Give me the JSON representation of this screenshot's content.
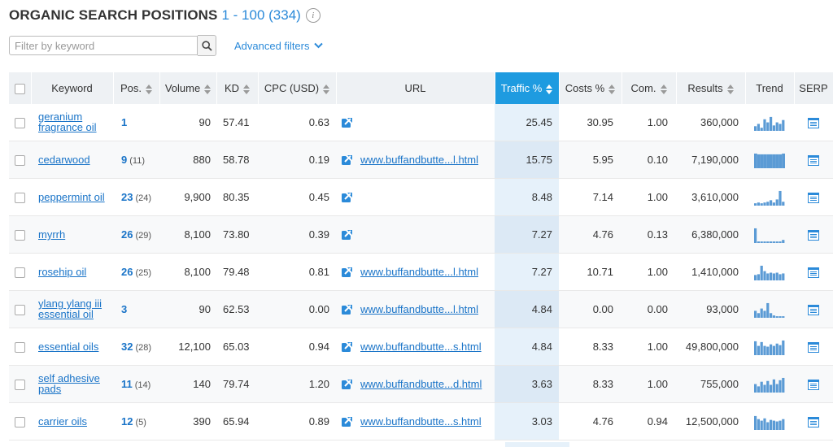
{
  "header": {
    "title": "ORGANIC SEARCH POSITIONS",
    "range": "1 - 100 (334)",
    "info_icon": "info-icon"
  },
  "filter": {
    "placeholder": "Filter by keyword",
    "search_icon": "magnifier-icon",
    "advanced_label": "Advanced filters"
  },
  "columns": {
    "keyword": "Keyword",
    "pos": "Pos.",
    "volume": "Volume",
    "kd": "KD",
    "cpc": "CPC (USD)",
    "url": "URL",
    "traffic": "Traffic %",
    "costs": "Costs %",
    "com": "Com.",
    "results": "Results",
    "trend": "Trend",
    "serp": "SERP"
  },
  "colors": {
    "accent": "#1e9be0",
    "link": "#1a74c8",
    "trend_bar": "#5b9bd5"
  },
  "rows": [
    {
      "keyword": "geranium fragrance oil",
      "pos": "1",
      "prev": "",
      "volume": "90",
      "kd": "57.41",
      "cpc": "0.63",
      "url": "",
      "traffic": "25.45",
      "costs": "30.95",
      "com": "1.00",
      "results": "360,000",
      "trend": [
        0.3,
        0.45,
        0.2,
        0.75,
        0.55,
        0.9,
        0.35,
        0.55,
        0.45,
        0.7
      ]
    },
    {
      "keyword": "cedarwood",
      "pos": "9",
      "prev": "(11)",
      "volume": "880",
      "kd": "58.78",
      "cpc": "0.19",
      "url": "www.buffandbutte...l.html",
      "traffic": "15.75",
      "costs": "5.95",
      "com": "0.10",
      "results": "7,190,000",
      "trend": [
        0.95,
        0.9,
        0.9,
        0.9,
        0.9,
        0.9,
        0.9,
        0.9,
        0.9,
        0.95
      ]
    },
    {
      "keyword": "peppermint oil",
      "pos": "23",
      "prev": "(24)",
      "volume": "9,900",
      "kd": "80.35",
      "cpc": "0.45",
      "url": "",
      "traffic": "8.48",
      "costs": "7.14",
      "com": "1.00",
      "results": "3,610,000",
      "trend": [
        0.15,
        0.2,
        0.15,
        0.2,
        0.25,
        0.35,
        0.2,
        0.4,
        0.95,
        0.25
      ]
    },
    {
      "keyword": "myrrh",
      "pos": "26",
      "prev": "(29)",
      "volume": "8,100",
      "kd": "73.80",
      "cpc": "0.39",
      "url": "",
      "traffic": "7.27",
      "costs": "4.76",
      "com": "0.13",
      "results": "6,380,000",
      "trend": [
        0.95,
        0.1,
        0.1,
        0.1,
        0.1,
        0.1,
        0.1,
        0.1,
        0.1,
        0.2
      ]
    },
    {
      "keyword": "rosehip oil",
      "pos": "26",
      "prev": "(25)",
      "volume": "8,100",
      "kd": "79.48",
      "cpc": "0.81",
      "url": "www.buffandbutte...l.html",
      "traffic": "7.27",
      "costs": "10.71",
      "com": "1.00",
      "results": "1,410,000",
      "trend": [
        0.35,
        0.4,
        0.95,
        0.6,
        0.45,
        0.5,
        0.45,
        0.5,
        0.4,
        0.45
      ]
    },
    {
      "keyword": "ylang ylang iii essential oil",
      "pos": "3",
      "prev": "",
      "volume": "90",
      "kd": "62.53",
      "cpc": "0.00",
      "url": "www.buffandbutte...l.html",
      "traffic": "4.84",
      "costs": "0.00",
      "com": "0.00",
      "results": "93,000",
      "trend": [
        0.45,
        0.3,
        0.6,
        0.45,
        0.95,
        0.3,
        0.15,
        0.1,
        0.1,
        0.1
      ]
    },
    {
      "keyword": "essential oils",
      "pos": "32",
      "prev": "(28)",
      "volume": "12,100",
      "kd": "65.03",
      "cpc": "0.94",
      "url": "www.buffandbutte...s.html",
      "traffic": "4.84",
      "costs": "8.33",
      "com": "1.00",
      "results": "49,800,000",
      "trend": [
        0.9,
        0.6,
        0.85,
        0.6,
        0.55,
        0.7,
        0.6,
        0.75,
        0.65,
        0.95
      ]
    },
    {
      "keyword": "self adhesive pads",
      "pos": "11",
      "prev": "(14)",
      "volume": "140",
      "kd": "79.74",
      "cpc": "1.20",
      "url": "www.buffandbutte...d.html",
      "traffic": "3.63",
      "costs": "8.33",
      "com": "1.00",
      "results": "755,000",
      "trend": [
        0.55,
        0.4,
        0.7,
        0.5,
        0.75,
        0.5,
        0.85,
        0.55,
        0.8,
        0.95
      ]
    },
    {
      "keyword": "carrier oils",
      "pos": "12",
      "prev": "(5)",
      "volume": "390",
      "kd": "65.94",
      "cpc": "0.89",
      "url": "www.buffandbutte...s.html",
      "traffic": "3.03",
      "costs": "4.76",
      "com": "0.94",
      "results": "12,500,000",
      "trend": [
        0.9,
        0.7,
        0.6,
        0.75,
        0.5,
        0.65,
        0.6,
        0.55,
        0.6,
        0.7
      ]
    }
  ]
}
